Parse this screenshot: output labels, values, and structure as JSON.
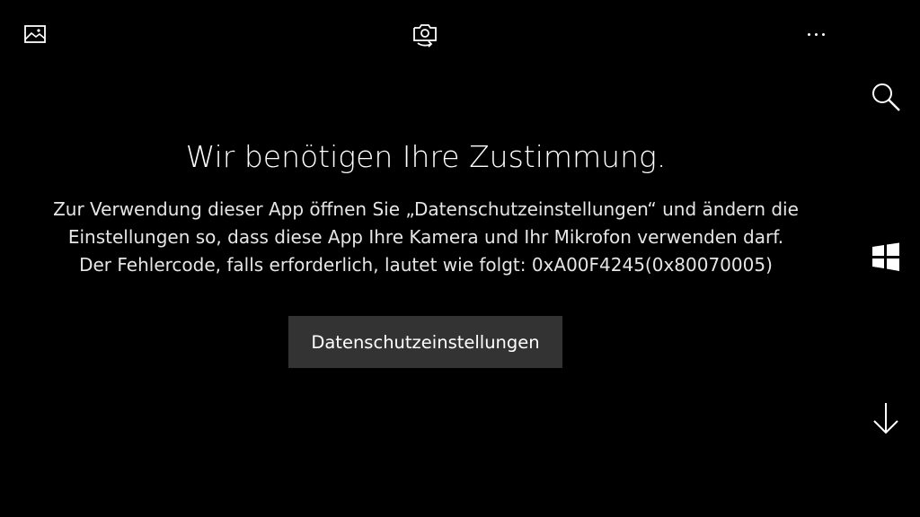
{
  "topbar": {
    "gallery_icon": "photo-gallery-icon",
    "switch_camera_icon": "switch-camera-icon",
    "more_icon": "more-options-icon"
  },
  "sidebar": {
    "search_icon": "search-icon",
    "windows_icon": "windows-logo-icon",
    "down_icon": "arrow-down-icon"
  },
  "consent": {
    "title": "Wir benötigen Ihre Zustimmung.",
    "message_lines": [
      "Zur Verwendung dieser App öffnen Sie „Datenschutzeinstellungen“ und ändern die",
      "Einstellungen so, dass diese App Ihre Kamera und Ihr Mikrofon verwenden darf.",
      "Der Fehlercode, falls erforderlich, lautet wie folgt: 0xA00F4245(0x80070005)"
    ],
    "button_label": "Datenschutzeinstellungen"
  },
  "colors": {
    "background": "#000000",
    "text": "#ffffff",
    "button_background": "#333333"
  }
}
